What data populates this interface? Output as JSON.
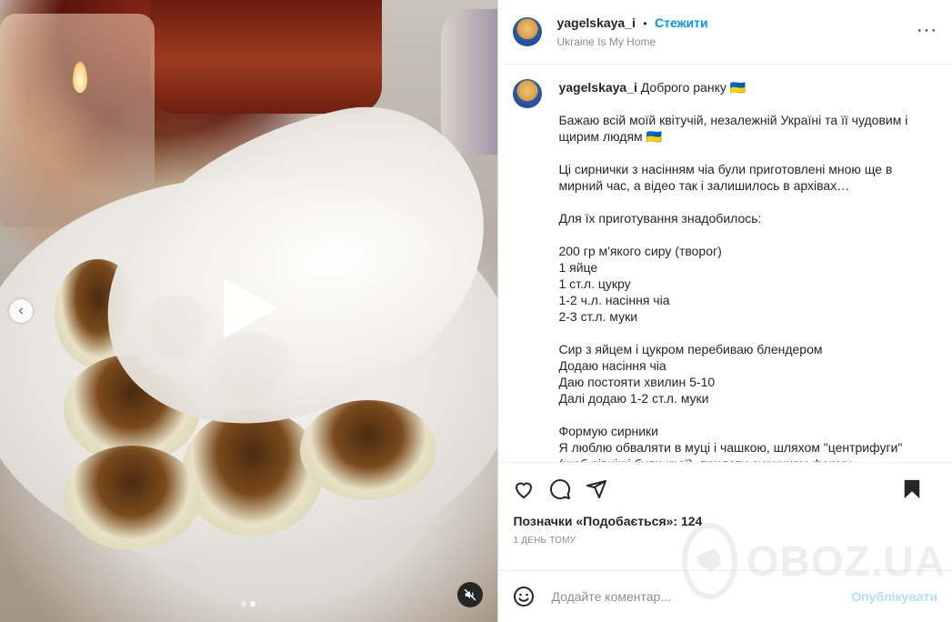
{
  "post": {
    "username": "yagelskaya_i",
    "separator": "•",
    "follow_label": "Стежити",
    "location": "Ukraine Is My Home",
    "more_label": "···"
  },
  "caption": {
    "username": "yagelskaya_i",
    "first_line": "Доброго ранку 🇺🇦",
    "lines": [
      "Бажаю всій моїй квітучій, незалежній Україні та її чудовим і щирим людям 🇺🇦",
      "",
      "Ці сирнички з насінням чіа були приготовлені мною ще в мирний час, а відео так і залишилось в архівах…",
      "",
      "Для їх приготування знадобилось:",
      "",
      "200 гр м'якого сиру (творог)",
      "1 яйце",
      "1 ст.л. цукру",
      "1-2 ч.л. насіння чіа",
      "2-3 ст.л. муки",
      "",
      "Сир з яйцем і цукром перебиваю блендером",
      "Додаю насіння чіа",
      "Даю постояти хвилин 5-10",
      "Далі додаю 1-2 ст.л. муки",
      "",
      "Формую сирники",
      "Я люблю обваляти в муці і чашкою, шляхом \"центрифуги\" (щоб рівніші були краї), придати сирникам форму"
    ]
  },
  "actions": {
    "like_icon": "heart-icon",
    "comment_icon": "comment-icon",
    "share_icon": "share-icon",
    "save_icon": "bookmark-icon"
  },
  "likes_text": "Позначки «Подобається»: 124",
  "time_text": "1 ДЕНЬ ТОМУ",
  "comment": {
    "placeholder": "Додайте коментар...",
    "publish_label": "Опублікувати"
  },
  "media": {
    "prev_label": "‹",
    "dots": 2,
    "active_dot": 1
  },
  "watermark": {
    "text": "OBOZ.UA"
  }
}
